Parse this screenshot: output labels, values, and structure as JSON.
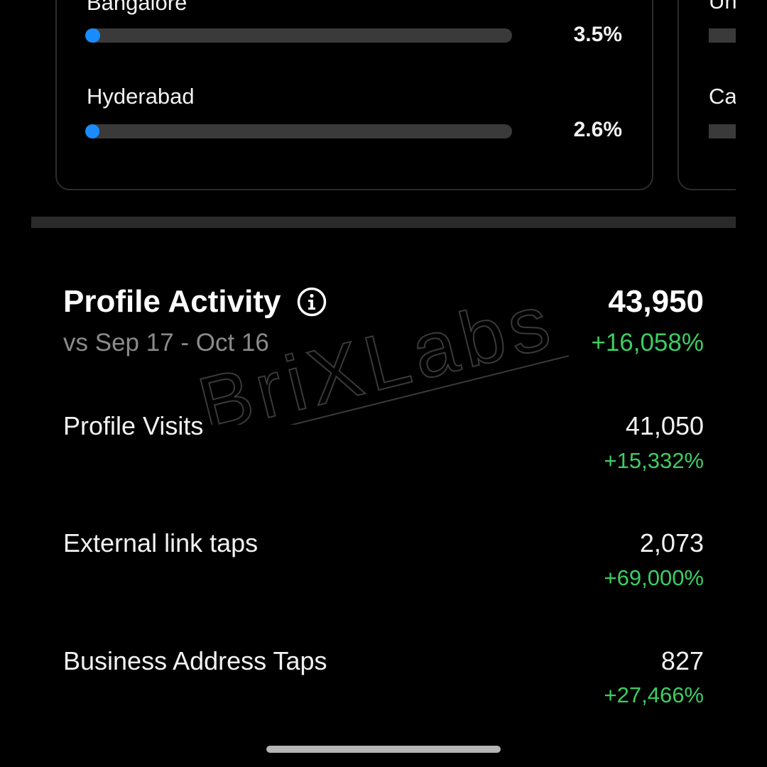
{
  "top_cities": {
    "items": [
      {
        "name": "Bangalore",
        "value": "3.5%",
        "fraction": 0.035
      },
      {
        "name": "Hyderabad",
        "value": "2.6%",
        "fraction": 0.026
      }
    ],
    "side_panel_items": [
      {
        "name": "Un"
      },
      {
        "name": "Ca"
      }
    ]
  },
  "profile_activity": {
    "title": "Profile Activity",
    "info_icon": "info-circle-icon",
    "total": "43,950",
    "comparison": "vs Sep 17 - Oct 16",
    "total_change": "+16,058%",
    "metrics": [
      {
        "label": "Profile Visits",
        "value": "41,050",
        "change": "+15,332%"
      },
      {
        "label": "External link taps",
        "value": "2,073",
        "change": "+69,000%"
      },
      {
        "label": "Business Address Taps",
        "value": "827",
        "change": "+27,466%"
      }
    ]
  },
  "watermark": {
    "text": "BriXLabs"
  },
  "colors": {
    "background": "#000000",
    "bar_fill": "#1a8cff",
    "bar_track": "#3a3a3a",
    "positive": "#3ccd63",
    "muted": "#8a8a8a"
  }
}
